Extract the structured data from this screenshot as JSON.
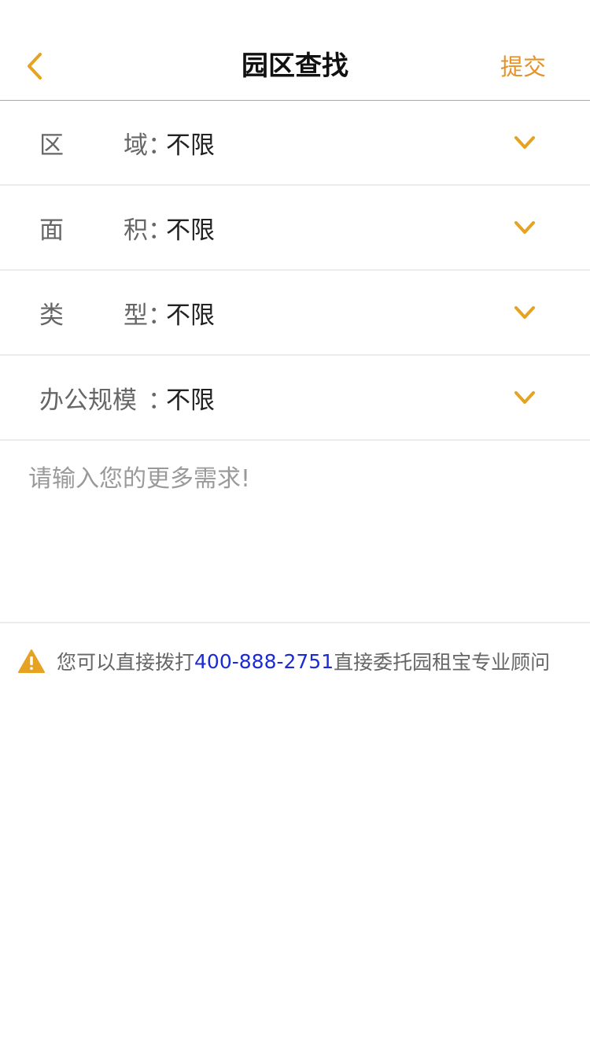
{
  "nav": {
    "title": "园区查找",
    "submit_label": "提交",
    "back_icon": "chevron-left-icon",
    "accent_color": "#e6a323"
  },
  "filters": [
    {
      "label_a": "区",
      "label_b": "域",
      "colon": "：",
      "value": "不限"
    },
    {
      "label_a": "面",
      "label_b": "积",
      "colon": "：",
      "value": "不限"
    },
    {
      "label_a": "类",
      "label_b": "型",
      "colon": "：",
      "value": "不限"
    },
    {
      "label_a": "办公规模",
      "label_b": "",
      "colon": "：",
      "value": "不限"
    }
  ],
  "requirements": {
    "placeholder": "请输入您的更多需求!",
    "value": ""
  },
  "notice": {
    "icon": "warning-icon",
    "prefix": "您可以直接拨打",
    "phone": "400-888-2751",
    "suffix": "直接委托园租宝专业顾问",
    "phone_color": "#1a2ad8"
  }
}
